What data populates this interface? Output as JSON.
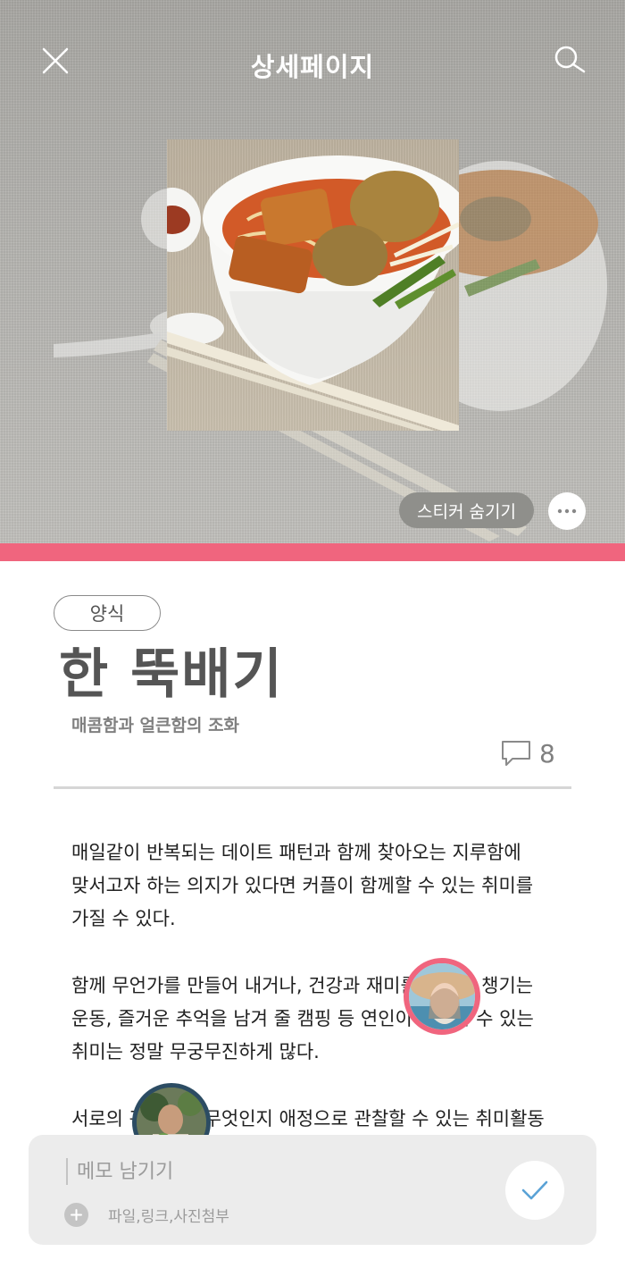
{
  "header": {
    "title": "상세페이지",
    "close_icon": "close-icon",
    "search_icon": "search-icon"
  },
  "hero": {
    "image_subject": "curry noodle soup in white bowl with chopsticks",
    "sticker_hide_label": "스티커 숨기기",
    "more_icon": "more-dots-icon"
  },
  "article": {
    "category": "양식",
    "title": "한 뚝배기",
    "subtitle": "매콤함과 얼큰함의 조화",
    "comment_count": "8",
    "paragraphs": [
      [
        "매일같이 반복되는 데이트 패턴과 함께 찾아오는 지루함에",
        "맞서고자 하는 의지가 있다면 커플이 함께할 수 있는 취미를",
        "가질 수 있다."
      ],
      [
        "함께 무언가를 만들어 내거나, 건강과 재미를 동시에 챙기는",
        "운동, 즐거운 추억을 남겨 줄 캠핑 등 연인이 함께할 수 있는",
        "취미는 정말 무궁무진하게 많다."
      ],
      [
        "서로의 관심사가 무엇인지 애정으로 관찰할 수 있는 취미활동"
      ]
    ]
  },
  "stickers": [
    {
      "kind": "avatar",
      "name": "woman-in-straw-hat",
      "border_color": "#f0657e"
    },
    {
      "kind": "avatar",
      "name": "person-with-plants",
      "border_color": "#2c4c63"
    }
  ],
  "memo": {
    "placeholder": "메모 남기기",
    "attach_label": "파일,링크,사진첨부",
    "submit_icon": "check-icon"
  },
  "colors": {
    "accent": "#f0657e",
    "check": "#5aa2d6"
  }
}
